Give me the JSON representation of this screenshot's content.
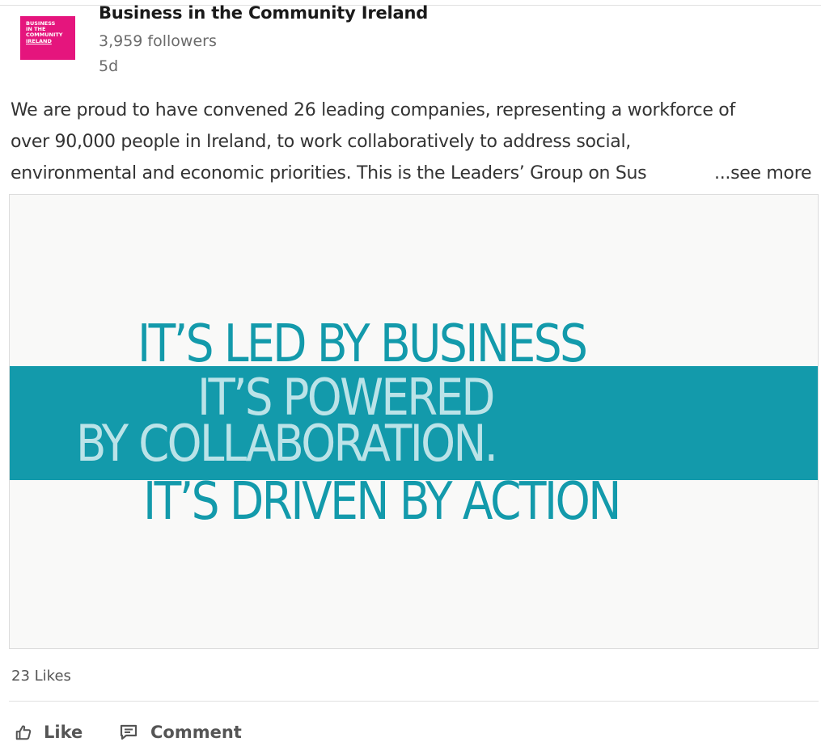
{
  "post": {
    "author": {
      "name": "Business in the Community Ireland",
      "followers": "3,959 followers",
      "age": "5d",
      "logo_lines": [
        "BUSINESS",
        "IN THE",
        "COMMUNITY",
        "IRELAND"
      ],
      "logo_color": "#e5157d"
    },
    "body": {
      "line1": "We are proud to have convened 26 leading companies, representing a workforce of",
      "line2": "over 90,000 people in Ireland, to work collaboratively to address social,",
      "line3": "environmental and economic priorities. This is the Leaders’ Group on Sus",
      "see_more": "...see more"
    },
    "media": {
      "slogan": [
        "IT’S LED BY BUSINESS",
        "IT’S POWERED",
        "BY COLLABORATION.",
        "IT’S DRIVEN BY ACTION"
      ],
      "accent_color": "#139aab"
    },
    "social": {
      "likes": "23 Likes"
    },
    "actions": {
      "like_label": "Like",
      "like_icon": "thumbs-up-icon",
      "comment_label": "Comment",
      "comment_icon": "comment-icon"
    }
  }
}
